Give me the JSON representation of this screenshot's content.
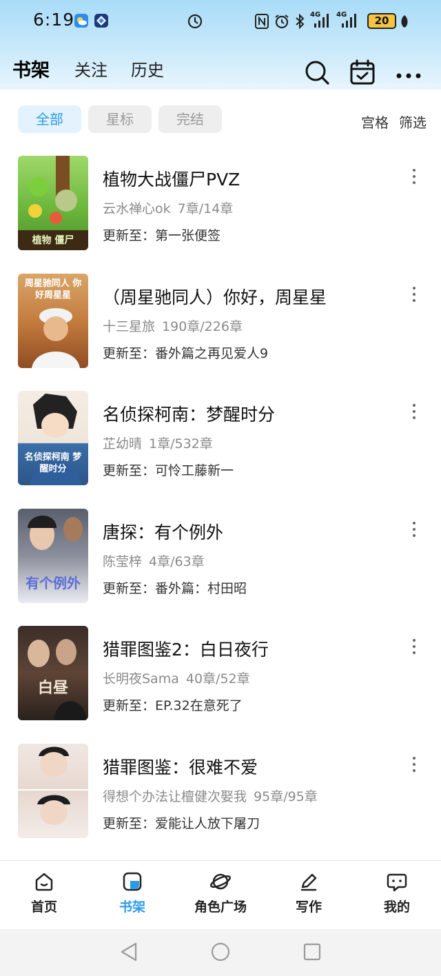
{
  "status_bar": {
    "time": "6:19",
    "battery": "20",
    "network_1": "4G",
    "network_2": "4G",
    "icons": [
      "weather-icon",
      "app-icon",
      "data-saver-icon",
      "nfc-icon",
      "alarm-icon",
      "bluetooth-icon",
      "signal-icon",
      "signal-icon",
      "leaf-icon"
    ]
  },
  "header": {
    "tabs": [
      {
        "label": "书架",
        "active": true
      },
      {
        "label": "关注",
        "active": false
      },
      {
        "label": "历史",
        "active": false
      }
    ],
    "icons": [
      "search-icon",
      "calendar-check-icon",
      "more-horizontal-icon"
    ]
  },
  "filters": {
    "chips": [
      {
        "label": "全部",
        "active": true
      },
      {
        "label": "星标",
        "active": false
      },
      {
        "label": "完结",
        "active": false
      }
    ],
    "grid_label": "宫格",
    "filter_label": "筛选"
  },
  "books": [
    {
      "title": "植物大战僵尸PVZ",
      "author": "云水禅心ok",
      "progress": "7章/14章",
      "update": "更新至：第一张便签",
      "cover_text": "植物 僵尸"
    },
    {
      "title": "（周星驰同人）你好，周星星",
      "author": "十三星旅",
      "progress": "190章/226章",
      "update": "更新至：番外篇之再见爱人9",
      "cover_text": "周星驰同人 你好周星星"
    },
    {
      "title": "名侦探柯南：梦醒时分",
      "author": "芷幼晴",
      "progress": "1章/532章",
      "update": "更新至：可怜工藤新一",
      "cover_text": "名侦探柯南 梦醒时分"
    },
    {
      "title": "唐探：有个例外",
      "author": "陈莹梓",
      "progress": "4章/63章",
      "update": "更新至：番外篇：村田昭",
      "cover_text": "有个例外"
    },
    {
      "title": "猎罪图鉴2：白日夜行",
      "author": "长明夜Sama",
      "progress": "40章/52章",
      "update": "更新至：EP.32在意死了",
      "cover_text": "白昼"
    },
    {
      "title": "猎罪图鉴：很难不爱",
      "author": "得想个办法让檀健次娶我",
      "progress": "95章/95章",
      "update": "更新至：爱能让人放下屠刀",
      "cover_text": ""
    }
  ],
  "bottom_nav": [
    {
      "label": "首页",
      "icon": "home-icon",
      "active": false
    },
    {
      "label": "书架",
      "icon": "bookshelf-icon",
      "active": true
    },
    {
      "label": "角色广场",
      "icon": "planet-icon",
      "active": false
    },
    {
      "label": "写作",
      "icon": "pen-icon",
      "active": false
    },
    {
      "label": "我的",
      "icon": "chat-bubble-icon",
      "active": false
    }
  ],
  "colors": {
    "accent": "#2b9be8",
    "header_gradient_top": "#a9dcf7",
    "chip_active_bg": "#e3f2fd",
    "battery": "#f5c542"
  }
}
